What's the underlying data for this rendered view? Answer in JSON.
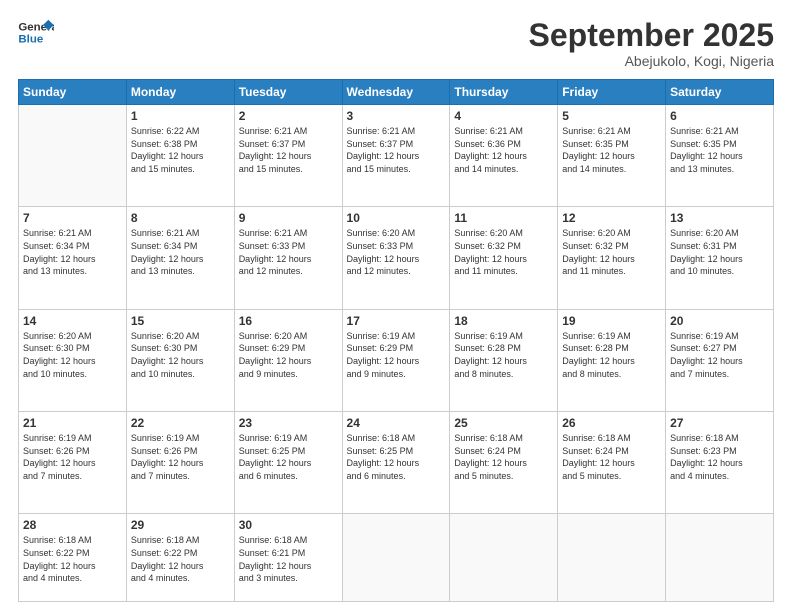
{
  "logo": {
    "line1": "General",
    "line2": "Blue"
  },
  "title": "September 2025",
  "subtitle": "Abejukolo, Kogi, Nigeria",
  "days_header": [
    "Sunday",
    "Monday",
    "Tuesday",
    "Wednesday",
    "Thursday",
    "Friday",
    "Saturday"
  ],
  "weeks": [
    [
      {
        "num": "",
        "info": ""
      },
      {
        "num": "1",
        "info": "Sunrise: 6:22 AM\nSunset: 6:38 PM\nDaylight: 12 hours\nand 15 minutes."
      },
      {
        "num": "2",
        "info": "Sunrise: 6:21 AM\nSunset: 6:37 PM\nDaylight: 12 hours\nand 15 minutes."
      },
      {
        "num": "3",
        "info": "Sunrise: 6:21 AM\nSunset: 6:37 PM\nDaylight: 12 hours\nand 15 minutes."
      },
      {
        "num": "4",
        "info": "Sunrise: 6:21 AM\nSunset: 6:36 PM\nDaylight: 12 hours\nand 14 minutes."
      },
      {
        "num": "5",
        "info": "Sunrise: 6:21 AM\nSunset: 6:35 PM\nDaylight: 12 hours\nand 14 minutes."
      },
      {
        "num": "6",
        "info": "Sunrise: 6:21 AM\nSunset: 6:35 PM\nDaylight: 12 hours\nand 13 minutes."
      }
    ],
    [
      {
        "num": "7",
        "info": "Sunrise: 6:21 AM\nSunset: 6:34 PM\nDaylight: 12 hours\nand 13 minutes."
      },
      {
        "num": "8",
        "info": "Sunrise: 6:21 AM\nSunset: 6:34 PM\nDaylight: 12 hours\nand 13 minutes."
      },
      {
        "num": "9",
        "info": "Sunrise: 6:21 AM\nSunset: 6:33 PM\nDaylight: 12 hours\nand 12 minutes."
      },
      {
        "num": "10",
        "info": "Sunrise: 6:20 AM\nSunset: 6:33 PM\nDaylight: 12 hours\nand 12 minutes."
      },
      {
        "num": "11",
        "info": "Sunrise: 6:20 AM\nSunset: 6:32 PM\nDaylight: 12 hours\nand 11 minutes."
      },
      {
        "num": "12",
        "info": "Sunrise: 6:20 AM\nSunset: 6:32 PM\nDaylight: 12 hours\nand 11 minutes."
      },
      {
        "num": "13",
        "info": "Sunrise: 6:20 AM\nSunset: 6:31 PM\nDaylight: 12 hours\nand 10 minutes."
      }
    ],
    [
      {
        "num": "14",
        "info": "Sunrise: 6:20 AM\nSunset: 6:30 PM\nDaylight: 12 hours\nand 10 minutes."
      },
      {
        "num": "15",
        "info": "Sunrise: 6:20 AM\nSunset: 6:30 PM\nDaylight: 12 hours\nand 10 minutes."
      },
      {
        "num": "16",
        "info": "Sunrise: 6:20 AM\nSunset: 6:29 PM\nDaylight: 12 hours\nand 9 minutes."
      },
      {
        "num": "17",
        "info": "Sunrise: 6:19 AM\nSunset: 6:29 PM\nDaylight: 12 hours\nand 9 minutes."
      },
      {
        "num": "18",
        "info": "Sunrise: 6:19 AM\nSunset: 6:28 PM\nDaylight: 12 hours\nand 8 minutes."
      },
      {
        "num": "19",
        "info": "Sunrise: 6:19 AM\nSunset: 6:28 PM\nDaylight: 12 hours\nand 8 minutes."
      },
      {
        "num": "20",
        "info": "Sunrise: 6:19 AM\nSunset: 6:27 PM\nDaylight: 12 hours\nand 7 minutes."
      }
    ],
    [
      {
        "num": "21",
        "info": "Sunrise: 6:19 AM\nSunset: 6:26 PM\nDaylight: 12 hours\nand 7 minutes."
      },
      {
        "num": "22",
        "info": "Sunrise: 6:19 AM\nSunset: 6:26 PM\nDaylight: 12 hours\nand 7 minutes."
      },
      {
        "num": "23",
        "info": "Sunrise: 6:19 AM\nSunset: 6:25 PM\nDaylight: 12 hours\nand 6 minutes."
      },
      {
        "num": "24",
        "info": "Sunrise: 6:18 AM\nSunset: 6:25 PM\nDaylight: 12 hours\nand 6 minutes."
      },
      {
        "num": "25",
        "info": "Sunrise: 6:18 AM\nSunset: 6:24 PM\nDaylight: 12 hours\nand 5 minutes."
      },
      {
        "num": "26",
        "info": "Sunrise: 6:18 AM\nSunset: 6:24 PM\nDaylight: 12 hours\nand 5 minutes."
      },
      {
        "num": "27",
        "info": "Sunrise: 6:18 AM\nSunset: 6:23 PM\nDaylight: 12 hours\nand 4 minutes."
      }
    ],
    [
      {
        "num": "28",
        "info": "Sunrise: 6:18 AM\nSunset: 6:22 PM\nDaylight: 12 hours\nand 4 minutes."
      },
      {
        "num": "29",
        "info": "Sunrise: 6:18 AM\nSunset: 6:22 PM\nDaylight: 12 hours\nand 4 minutes."
      },
      {
        "num": "30",
        "info": "Sunrise: 6:18 AM\nSunset: 6:21 PM\nDaylight: 12 hours\nand 3 minutes."
      },
      {
        "num": "",
        "info": ""
      },
      {
        "num": "",
        "info": ""
      },
      {
        "num": "",
        "info": ""
      },
      {
        "num": "",
        "info": ""
      }
    ]
  ]
}
